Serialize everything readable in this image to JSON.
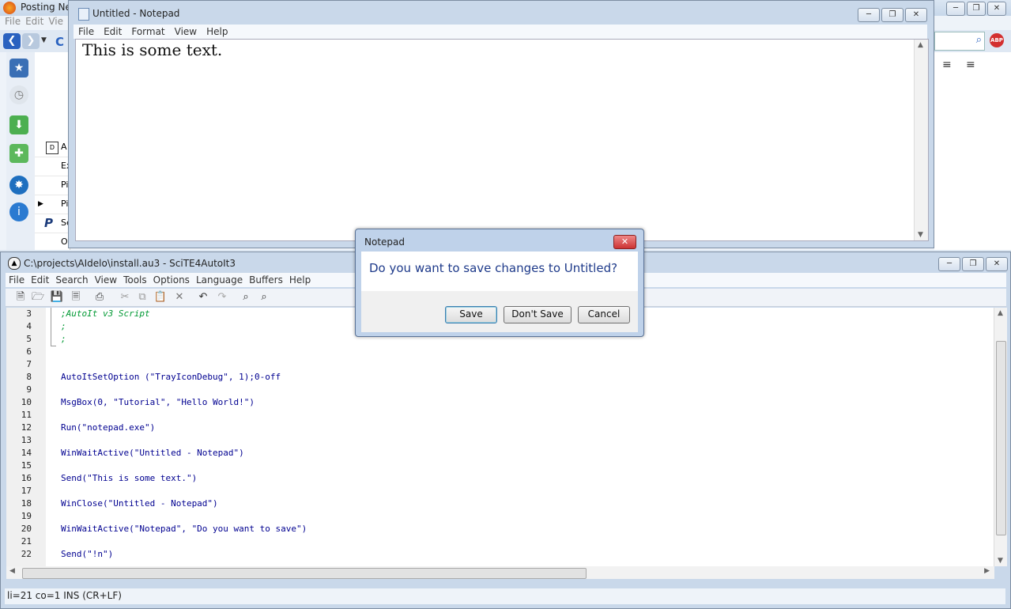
{
  "firefox": {
    "title": "Posting Ne",
    "menu": [
      "File",
      "Edit",
      "Vie"
    ],
    "list_items": [
      "A",
      "Ex",
      "Pi",
      "Pi",
      "Se",
      "O"
    ]
  },
  "notepad": {
    "title": "Untitled - Notepad",
    "menu": [
      "File",
      "Edit",
      "Format",
      "View",
      "Help"
    ],
    "content": "This is some text."
  },
  "scite": {
    "title": "C:\\projects\\AIdelo\\install.au3 - SciTE4AutoIt3",
    "menu": [
      "File",
      "Edit",
      "Search",
      "View",
      "Tools",
      "Options",
      "Language",
      "Buffers",
      "Help"
    ],
    "status": "li=21 co=1 INS (CR+LF)",
    "lines": [
      {
        "n": "3",
        "code": ";AutoIt v3 Script"
      },
      {
        "n": "4",
        "code": ";"
      },
      {
        "n": "5",
        "code": ";"
      },
      {
        "n": "6",
        "code": ""
      },
      {
        "n": "7",
        "code": ""
      },
      {
        "n": "8",
        "code": "AutoItSetOption (\"TrayIconDebug\", 1);0-off"
      },
      {
        "n": "9",
        "code": ""
      },
      {
        "n": "10",
        "code": "MsgBox(0, \"Tutorial\", \"Hello World!\")"
      },
      {
        "n": "11",
        "code": ""
      },
      {
        "n": "12",
        "code": "Run(\"notepad.exe\")"
      },
      {
        "n": "13",
        "code": ""
      },
      {
        "n": "14",
        "code": "WinWaitActive(\"Untitled - Notepad\")"
      },
      {
        "n": "15",
        "code": ""
      },
      {
        "n": "16",
        "code": "Send(\"This is some text.\")"
      },
      {
        "n": "17",
        "code": ""
      },
      {
        "n": "18",
        "code": "WinClose(\"Untitled - Notepad\")"
      },
      {
        "n": "19",
        "code": ""
      },
      {
        "n": "20",
        "code": "WinWaitActive(\"Notepad\", \"Do you want to save\")"
      },
      {
        "n": "21",
        "code": ""
      },
      {
        "n": "22",
        "code": "Send(\"!n\")"
      }
    ]
  },
  "dialog": {
    "title": "Notepad",
    "message": "Do you want to save changes to Untitled?",
    "save": "Save",
    "dont_save": "Don't Save",
    "cancel": "Cancel"
  },
  "colors": {
    "keyword": "#000090",
    "comment": "#009933",
    "string": "#888888",
    "number": "#cc0000"
  }
}
